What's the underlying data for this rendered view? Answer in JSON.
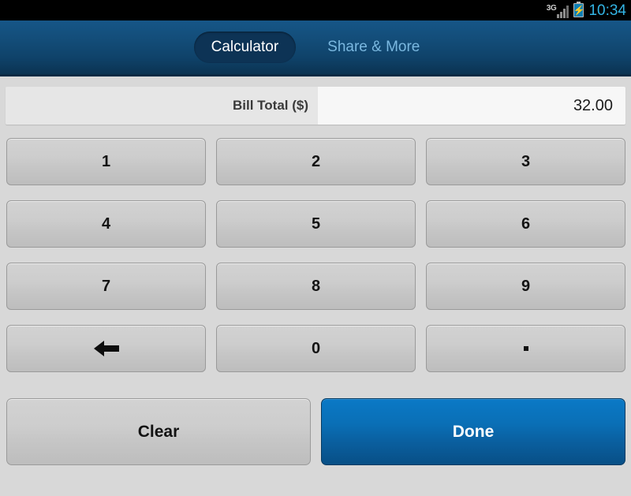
{
  "statusbar": {
    "network_label": "3G",
    "signal_icon": "signal-bars-icon",
    "battery_icon": "battery-charging-icon",
    "battery_glyph": "⚡",
    "clock": "10:34",
    "clock_color": "#33b5e5"
  },
  "header": {
    "tabs": [
      {
        "label": "Calculator",
        "active": true
      },
      {
        "label": "Share & More",
        "active": false
      }
    ],
    "gradient_top": "#165687",
    "gradient_bottom": "#0b3352",
    "active_pill_color": "#0d3355",
    "inactive_tab_color": "#7ab8e0"
  },
  "bill_field": {
    "label": "Bill Total ($)",
    "value": "32.00",
    "label_bg": "#e6e6e6",
    "value_bg": "#f7f7f7"
  },
  "keypad": {
    "rows": [
      [
        {
          "label": "1",
          "icon": null
        },
        {
          "label": "2",
          "icon": null
        },
        {
          "label": "3",
          "icon": null
        }
      ],
      [
        {
          "label": "4",
          "icon": null
        },
        {
          "label": "5",
          "icon": null
        },
        {
          "label": "6",
          "icon": null
        }
      ],
      [
        {
          "label": "7",
          "icon": null
        },
        {
          "label": "8",
          "icon": null
        },
        {
          "label": "9",
          "icon": null
        }
      ],
      [
        {
          "label": "",
          "icon": "backspace-arrow-icon"
        },
        {
          "label": "0",
          "icon": null
        },
        {
          "label": "",
          "icon": "decimal-point-icon"
        }
      ]
    ]
  },
  "actions": {
    "clear_label": "Clear",
    "done_label": "Done",
    "done_color": "#0a6fb6"
  }
}
